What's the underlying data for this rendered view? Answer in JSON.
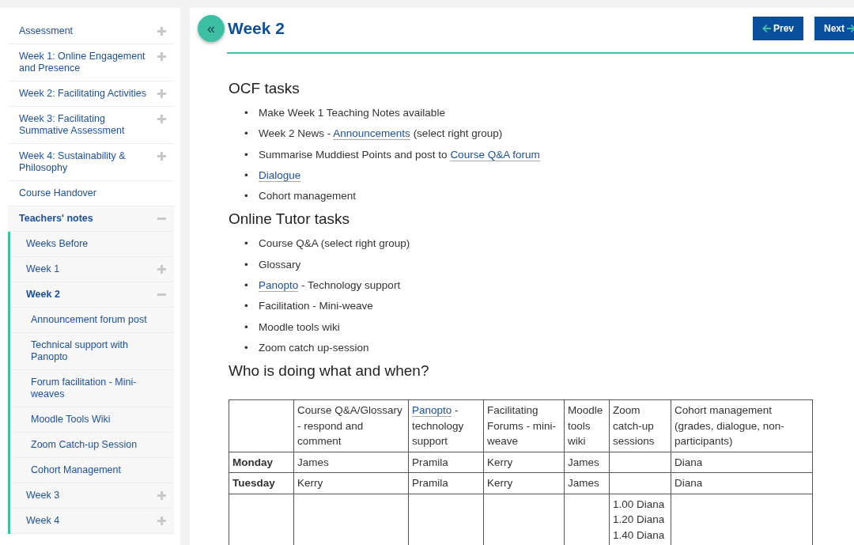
{
  "sidebar": {
    "items": [
      {
        "label": "Assessment",
        "expanded": false
      },
      {
        "label": "Week 1: Online Engagement and Presence",
        "expanded": false
      },
      {
        "label": "Week 2: Facilitating Activities",
        "expanded": false
      },
      {
        "label": "Week 3: Facilitating Summative Assessment",
        "expanded": false
      },
      {
        "label": "Week 4: Sustainability & Philosophy",
        "expanded": false
      },
      {
        "label": "Course Handover"
      },
      {
        "label": "Teachers' notes",
        "expanded": true,
        "children": [
          {
            "label": "Weeks Before"
          },
          {
            "label": "Week 1",
            "expanded": false
          },
          {
            "label": "Week 2",
            "expanded": true,
            "children": [
              {
                "label": "Announcement forum post"
              },
              {
                "label": "Technical support with Panopto"
              },
              {
                "label": "Forum facilitation - Mini-weaves"
              },
              {
                "label": "Moodle Tools Wiki"
              },
              {
                "label": "Zoom Catch-up Session"
              },
              {
                "label": "Cohort Management"
              }
            ]
          },
          {
            "label": "Week 3",
            "expanded": false
          },
          {
            "label": "Week 4",
            "expanded": false
          }
        ]
      }
    ]
  },
  "collapse_button": "«",
  "page": {
    "title": "Week 2",
    "prev": "Prev",
    "next": "Next"
  },
  "sections": [
    {
      "heading": "OCF tasks",
      "bullet": "•",
      "items": [
        [
          {
            "text": "Make Week 1 Teaching Notes available"
          }
        ],
        [
          {
            "text": "Week 2 News - "
          },
          {
            "text": "Announcements",
            "link": true
          },
          {
            "text": " (select right group)"
          }
        ],
        [
          {
            "text": "Summarise Muddiest Points and post to "
          },
          {
            "text": "Course Q&A forum",
            "link": true
          }
        ],
        [
          {
            "text": "Dialogue",
            "link": true
          }
        ],
        [
          {
            "text": "Cohort management"
          }
        ]
      ]
    },
    {
      "heading": "Online Tutor tasks",
      "bullet": "•",
      "items": [
        [
          {
            "text": "Course Q&A (select right group)"
          }
        ],
        [
          {
            "text": "Glossary"
          }
        ],
        [
          {
            "text": "Panopto",
            "link": true
          },
          {
            "text": " - Technology support"
          }
        ],
        [
          {
            "text": "Facilitation - Mini-weave"
          }
        ],
        [
          {
            "text": "Moodle tools wiki"
          }
        ],
        [
          {
            "text": "Zoom catch up-session"
          }
        ]
      ]
    },
    {
      "heading": "Who is doing what and when?"
    }
  ],
  "table": {
    "columns": [
      {
        "parts": [
          {
            "text": "Course Q&A/Glossary - respond and comment"
          }
        ]
      },
      {
        "parts": [
          {
            "text": "Panopto",
            "link": true
          },
          {
            "text": " - technology support"
          }
        ]
      },
      {
        "parts": [
          {
            "text": "Facilitating Forums - mini-weave"
          }
        ]
      },
      {
        "parts": [
          {
            "text": "Moodle tools wiki"
          }
        ]
      },
      {
        "parts": [
          {
            "text": "Zoom catch-up sessions"
          }
        ]
      },
      {
        "parts": [
          {
            "text": "Cohort management (grades, dialogue, non-participants)"
          }
        ]
      }
    ],
    "rows": [
      {
        "day": "Monday",
        "cells": [
          [
            "James"
          ],
          [
            "Pramila"
          ],
          [
            "Kerry"
          ],
          [
            "James"
          ],
          [],
          [
            "Diana"
          ]
        ]
      },
      {
        "day": "Tuesday",
        "cells": [
          [
            "Kerry"
          ],
          [
            "Pramila"
          ],
          [
            "Kerry"
          ],
          [
            "James"
          ],
          [],
          [
            "Diana"
          ]
        ]
      },
      {
        "cells": [
          [],
          [],
          [],
          [],
          [
            "1.00 Diana",
            "1.20 Diana",
            "1.40 Diana"
          ],
          []
        ]
      }
    ]
  }
}
